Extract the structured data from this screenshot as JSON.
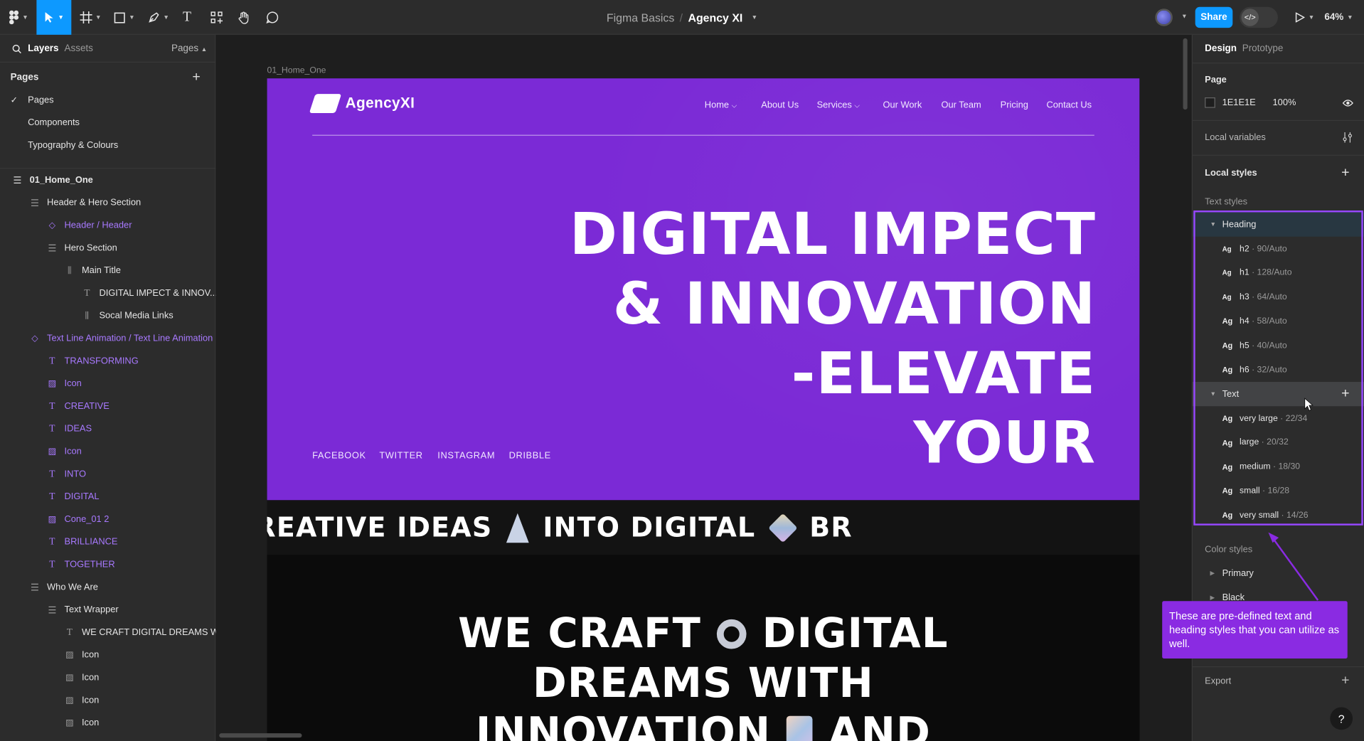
{
  "toolbar": {
    "project": "Figma Basics",
    "separator": "/",
    "file": "Agency XI",
    "share": "Share",
    "zoom": "64%",
    "devmode_glyph": "</>"
  },
  "left_panel": {
    "tabs": [
      "Layers",
      "Assets",
      "Pages"
    ],
    "pages_header": "Pages",
    "pages": [
      "Pages",
      "Components",
      "Typography & Colours"
    ],
    "layers": [
      {
        "label": "01_Home_One",
        "icon": "frame-icon",
        "indent": 0,
        "color": "default",
        "bold": true
      },
      {
        "label": "Header & Hero Section",
        "icon": "auto-layout-icon",
        "indent": 1,
        "color": "default"
      },
      {
        "label": "Header / Header",
        "icon": "component-instance-icon",
        "indent": 2,
        "color": "purple"
      },
      {
        "label": "Hero Section",
        "icon": "auto-layout-icon",
        "indent": 2,
        "color": "default"
      },
      {
        "label": "Main Title",
        "icon": "columns-icon",
        "indent": 3,
        "color": "default"
      },
      {
        "label": "DIGITAL IMPECT & INNOV...",
        "icon": "text-icon",
        "indent": 4,
        "color": "default"
      },
      {
        "label": "Socal Media Links",
        "icon": "columns-icon",
        "indent": 4,
        "color": "default"
      },
      {
        "label": "Text Line Animation / Text Line Animation",
        "icon": "component-instance-icon",
        "indent": 1,
        "color": "purple"
      },
      {
        "label": "TRANSFORMING",
        "icon": "text-icon",
        "indent": 2,
        "color": "purple"
      },
      {
        "label": "Icon",
        "icon": "image-icon",
        "indent": 2,
        "color": "purple"
      },
      {
        "label": "CREATIVE",
        "icon": "text-icon",
        "indent": 2,
        "color": "purple"
      },
      {
        "label": "IDEAS",
        "icon": "text-icon",
        "indent": 2,
        "color": "purple"
      },
      {
        "label": "Icon",
        "icon": "image-icon",
        "indent": 2,
        "color": "purple"
      },
      {
        "label": "INTO",
        "icon": "text-icon",
        "indent": 2,
        "color": "purple"
      },
      {
        "label": "DIGITAL",
        "icon": "text-icon",
        "indent": 2,
        "color": "purple"
      },
      {
        "label": "Cone_01 2",
        "icon": "image-icon",
        "indent": 2,
        "color": "purple"
      },
      {
        "label": "BRILLIANCE",
        "icon": "text-icon",
        "indent": 2,
        "color": "purple"
      },
      {
        "label": "TOGETHER",
        "icon": "text-icon",
        "indent": 2,
        "color": "purple"
      },
      {
        "label": "Who We Are",
        "icon": "auto-layout-icon",
        "indent": 1,
        "color": "default"
      },
      {
        "label": "Text Wrapper",
        "icon": "auto-layout-icon",
        "indent": 2,
        "color": "default"
      },
      {
        "label": "WE CRAFT DIGITAL DREAMS W...",
        "icon": "text-icon",
        "indent": 3,
        "color": "default"
      },
      {
        "label": "Icon",
        "icon": "image-icon",
        "indent": 3,
        "color": "default"
      },
      {
        "label": "Icon",
        "icon": "image-icon",
        "indent": 3,
        "color": "default"
      },
      {
        "label": "Icon",
        "icon": "image-icon",
        "indent": 3,
        "color": "default"
      },
      {
        "label": "Icon",
        "icon": "image-icon",
        "indent": 3,
        "color": "default"
      }
    ]
  },
  "canvas": {
    "frame_label": "01_Home_One",
    "logo_text": "AgencyXI",
    "nav": [
      "Home",
      "About Us",
      "Services",
      "Our Work",
      "Our Team",
      "Pricing",
      "Contact Us"
    ],
    "hero_lines": [
      "DIGITAL IMPECT",
      "& INNOVATION",
      "-ELEVATE",
      "YOUR"
    ],
    "social": [
      "FACEBOOK",
      "TWITTER",
      "INSTAGRAM",
      "DRIBBLE"
    ],
    "marquee": [
      "REATIVE IDEAS",
      "INTO DIGITAL",
      "BR"
    ],
    "section2_lines": [
      "WE CRAFT",
      "DIGITAL",
      "DREAMS WITH",
      "INNOVATION",
      "AND"
    ]
  },
  "right_panel": {
    "tabs": [
      "Design",
      "Prototype"
    ],
    "page_section": "Page",
    "page_color": "1E1E1E",
    "page_opacity": "100%",
    "local_variables": "Local variables",
    "local_styles": "Local styles",
    "text_styles": "Text styles",
    "heading_group": "Heading",
    "heading_styles": [
      {
        "name": "h2",
        "meta": "· 90/Auto"
      },
      {
        "name": "h1",
        "meta": "· 128/Auto"
      },
      {
        "name": "h3",
        "meta": "· 64/Auto"
      },
      {
        "name": "h4",
        "meta": "· 58/Auto"
      },
      {
        "name": "h5",
        "meta": "· 40/Auto"
      },
      {
        "name": "h6",
        "meta": "· 32/Auto"
      }
    ],
    "text_group": "Text",
    "text_styles_list": [
      {
        "name": "very large",
        "meta": "· 22/34"
      },
      {
        "name": "large",
        "meta": "· 20/32"
      },
      {
        "name": "medium",
        "meta": "· 18/30"
      },
      {
        "name": "small",
        "meta": "· 16/28"
      },
      {
        "name": "very small",
        "meta": "· 14/26"
      }
    ],
    "style_glyph": "Ag",
    "color_styles": "Color styles",
    "color_groups": [
      "Primary",
      "Black"
    ],
    "export": "Export"
  },
  "callout": "These are pre-defined text and heading styles that you can utilize as well.",
  "help": "?",
  "colors": {
    "accent": "#0d99ff",
    "selection": "#9747ff",
    "hero_bg": "#7b2ad6",
    "component": "#a879ff"
  }
}
